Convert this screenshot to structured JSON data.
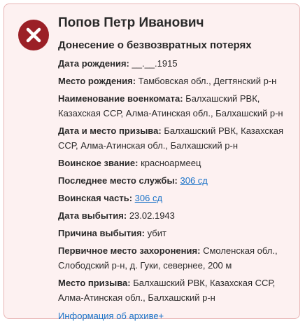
{
  "person": {
    "name": "Попов Петр Иванович",
    "document_type": "Донесение о безвозвратных потерях"
  },
  "fields": [
    {
      "label": "Дата рождения:",
      "value": "__.__.1915"
    },
    {
      "label": "Место рождения:",
      "value": "Тамбовская обл., Дегтянский р-н"
    },
    {
      "label": "Наименование военкомата:",
      "value": "Балхашский РВК, Казахская ССР, Алма-Атинская обл., Балхашский р-н"
    },
    {
      "label": "Дата и место призыва:",
      "value": "Балхашский РВК, Казахская ССР, Алма-Атинская обл., Балхашский р-н"
    },
    {
      "label": "Воинское звание:",
      "value": "красноармеец"
    },
    {
      "label": "Последнее место службы:",
      "value": "306 сд",
      "link": true
    },
    {
      "label": "Воинская часть:",
      "value": "306 сд",
      "link": true
    },
    {
      "label": "Дата выбытия:",
      "value": "23.02.1943"
    },
    {
      "label": "Причина выбытия:",
      "value": "убит"
    },
    {
      "label": "Первичное место захоронения:",
      "value": "Смоленская обл., Слободский р-н, д. Гуки, севернее, 200 м"
    },
    {
      "label": "Место призыва:",
      "value": "Балхашский РВК, Казахская ССР, Алма-Атинская обл., Балхашский р-н"
    }
  ],
  "archive_link": "Информация об архиве+",
  "icon": "close-x-icon",
  "colors": {
    "accent": "#9b2027",
    "link": "#1b73c8",
    "card_bg": "#fdf1f1",
    "card_border": "#e8b4b4"
  }
}
